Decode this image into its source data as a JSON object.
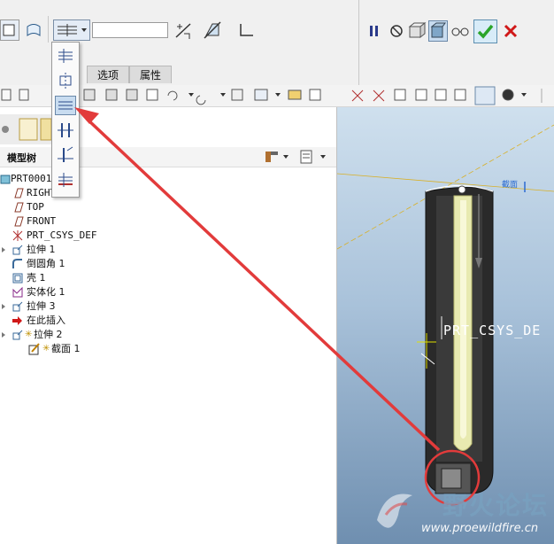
{
  "dashboard": {
    "depth_value": "",
    "tabs": [
      {
        "label": "选项"
      },
      {
        "label": "属性"
      }
    ]
  },
  "model_tree": {
    "title": "模型树",
    "items": [
      {
        "label": "PRT0001.",
        "icon": "part-icon"
      },
      {
        "label": "RIGHT",
        "icon": "datum-plane-icon"
      },
      {
        "label": "TOP",
        "icon": "datum-plane-icon"
      },
      {
        "label": "FRONT",
        "icon": "datum-plane-icon"
      },
      {
        "label": "PRT_CSYS_DEF",
        "icon": "coordinate-system-icon"
      },
      {
        "label": "拉伸 1",
        "icon": "extrude-icon"
      },
      {
        "label": "倒圆角 1",
        "icon": "round-icon"
      },
      {
        "label": "壳 1",
        "icon": "shell-icon"
      },
      {
        "label": "实体化 1",
        "icon": "solidify-icon"
      },
      {
        "label": "拉伸 3",
        "icon": "extrude-icon"
      },
      {
        "label": "在此插入",
        "icon": "insert-here-arrow-icon"
      },
      {
        "label": "拉伸 2",
        "icon": "extrude-icon"
      },
      {
        "label": "截面 1",
        "icon": "sketch-icon"
      }
    ]
  },
  "viewport": {
    "csys_label": "PRT_CSYS_DE",
    "datum_label": "截面"
  },
  "watermark": {
    "title": "野火论坛",
    "url": "www.proewildfire.cn"
  },
  "colors": {
    "annotation_red": "#e23b3b",
    "confirm_green": "#2aa52a",
    "cancel_red": "#d01818",
    "viewport_bg_top": "#cfe0ee",
    "viewport_bg_bottom": "#6f8fb0"
  }
}
